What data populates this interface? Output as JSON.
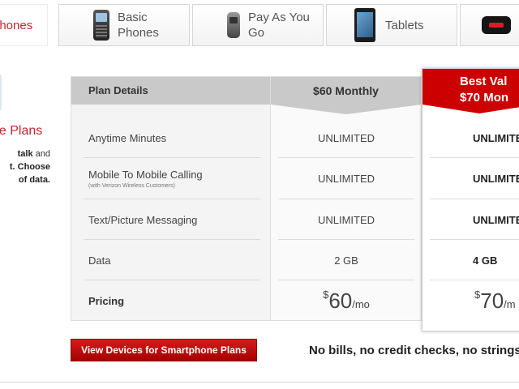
{
  "tabs": [
    {
      "label": "phones",
      "icon": "smartphone-icon",
      "active": true
    },
    {
      "label": "Basic Phones",
      "icon": "basic-phone-icon"
    },
    {
      "label": "Pay As You Go",
      "icon": "flip-phone-icon"
    },
    {
      "label": "Tablets",
      "icon": "tablet-icon"
    },
    {
      "label": "",
      "icon": "mobile-hotspot-icon"
    }
  ],
  "sidebar": {
    "title": "ne Plans",
    "desc_line1_bold": "talk",
    "desc_line1_rest": " and",
    "desc_line2": "t. Choose",
    "desc_line3": "of data."
  },
  "table": {
    "header_label": "Plan Details",
    "plan_60": {
      "header": "$60 Monthly"
    },
    "plan_70": {
      "badge_line1": "Best Val",
      "badge_line2": "$70 Mon"
    },
    "rows": [
      {
        "label": "Anytime Minutes",
        "sub": "",
        "v60": "UNLIMITED",
        "v70": "UNLIMITE"
      },
      {
        "label": "Mobile To Mobile Calling",
        "sub": "(with Verizon Wireless Customers)",
        "v60": "UNLIMITED",
        "v70": "UNLIMITE"
      },
      {
        "label": "Text/Picture Messaging",
        "sub": "",
        "v60": "UNLIMITED",
        "v70": "UNLIMITE"
      },
      {
        "label": "Data",
        "sub": "",
        "v60": "2 GB",
        "v70": "4 GB"
      },
      {
        "label": "Pricing",
        "sub": ""
      }
    ],
    "pricing": {
      "currency": "$",
      "p60_amount": "60",
      "p60_unit": "/mo",
      "p70_amount": "70",
      "p70_unit": "/m"
    }
  },
  "cta": {
    "label": "View Devices for Smartphone Plans"
  },
  "tagline": "No bills, no credit checks, no strings"
}
